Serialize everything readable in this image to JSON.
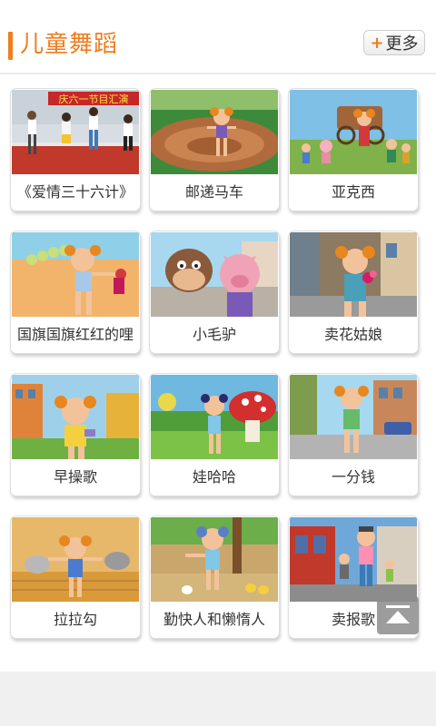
{
  "header": {
    "title": "儿童舞蹈",
    "more_label": "更多",
    "more_icon": "plus-icon"
  },
  "colors": {
    "accent": "#f07d1e",
    "page_bg": "#f0f0f0"
  },
  "videos": [
    {
      "title": "《爱情三十六计》",
      "banner": "庆六一节目汇演"
    },
    {
      "title": "邮递马车"
    },
    {
      "title": "亚克西"
    },
    {
      "title": "国旗国旗红红的哩"
    },
    {
      "title": "小毛驴"
    },
    {
      "title": "卖花姑娘"
    },
    {
      "title": "早操歌"
    },
    {
      "title": "娃哈哈"
    },
    {
      "title": "一分钱"
    },
    {
      "title": "拉拉勾"
    },
    {
      "title": "勤快人和懒惰人"
    },
    {
      "title": "卖报歌"
    }
  ],
  "scroll_top_icon": "arrow-to-top-icon"
}
